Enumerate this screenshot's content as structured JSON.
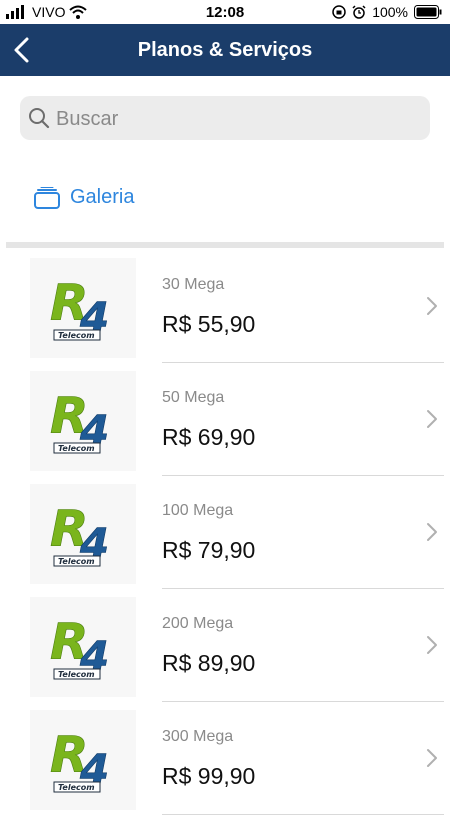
{
  "status_bar": {
    "carrier": "VIVO",
    "time": "12:08",
    "battery": "100%"
  },
  "header": {
    "title": "Planos & Serviços"
  },
  "search": {
    "placeholder": "Buscar"
  },
  "gallery": {
    "label": "Galeria"
  },
  "plans": [
    {
      "name": "30 Mega",
      "price": "R$ 55,90",
      "logo_sub": "Telecom"
    },
    {
      "name": "50 Mega",
      "price": "R$ 69,90",
      "logo_sub": "Telecom"
    },
    {
      "name": "100 Mega",
      "price": "R$ 79,90",
      "logo_sub": "Telecom"
    },
    {
      "name": "200 Mega",
      "price": "R$ 89,90",
      "logo_sub": "Telecom"
    },
    {
      "name": "300 Mega",
      "price": "R$ 99,90",
      "logo_sub": "Telecom"
    }
  ],
  "colors": {
    "nav_bg": "#1b3d6a",
    "accent": "#2e86de",
    "logo_green": "#7ab51d",
    "logo_blue": "#1f5a96"
  }
}
